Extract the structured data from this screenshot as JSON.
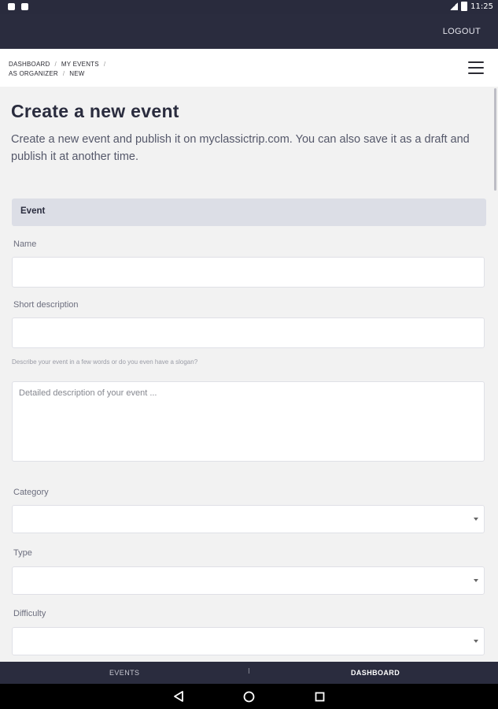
{
  "status_bar": {
    "time": "11:25"
  },
  "app_bar": {
    "logout_label": "LOGOUT"
  },
  "breadcrumb": {
    "items": [
      "DASHBOARD",
      "MY EVENTS",
      "AS ORGANIZER",
      "NEW"
    ]
  },
  "page": {
    "title": "Create a new event",
    "intro": "Create a new event and publish it on myclassictrip.com. You can also save it as a draft and publish it at another time."
  },
  "form": {
    "section_title": "Event",
    "name_label": "Name",
    "name_value": "",
    "short_desc_label": "Short description",
    "short_desc_value": "",
    "short_desc_hint": "Describe your event in a few words or do you even have a slogan?",
    "detailed_placeholder": "Detailed description of your event ...",
    "category_label": "Category",
    "category_value": "",
    "type_label": "Type",
    "type_value": "",
    "difficulty_label": "Difficulty",
    "difficulty_value": ""
  },
  "bottom_tabs": {
    "events_label": "EVENTS",
    "separator": "I",
    "dashboard_label": "DASHBOARD"
  },
  "icons": {
    "menu": "hamburger-menu-icon",
    "back": "back-triangle-icon",
    "home": "home-circle-icon",
    "recent": "recent-apps-square-icon"
  },
  "colors": {
    "header_bg": "#2a2c3e",
    "section_bg": "#dcdee6",
    "page_bg": "#f2f2f2"
  }
}
